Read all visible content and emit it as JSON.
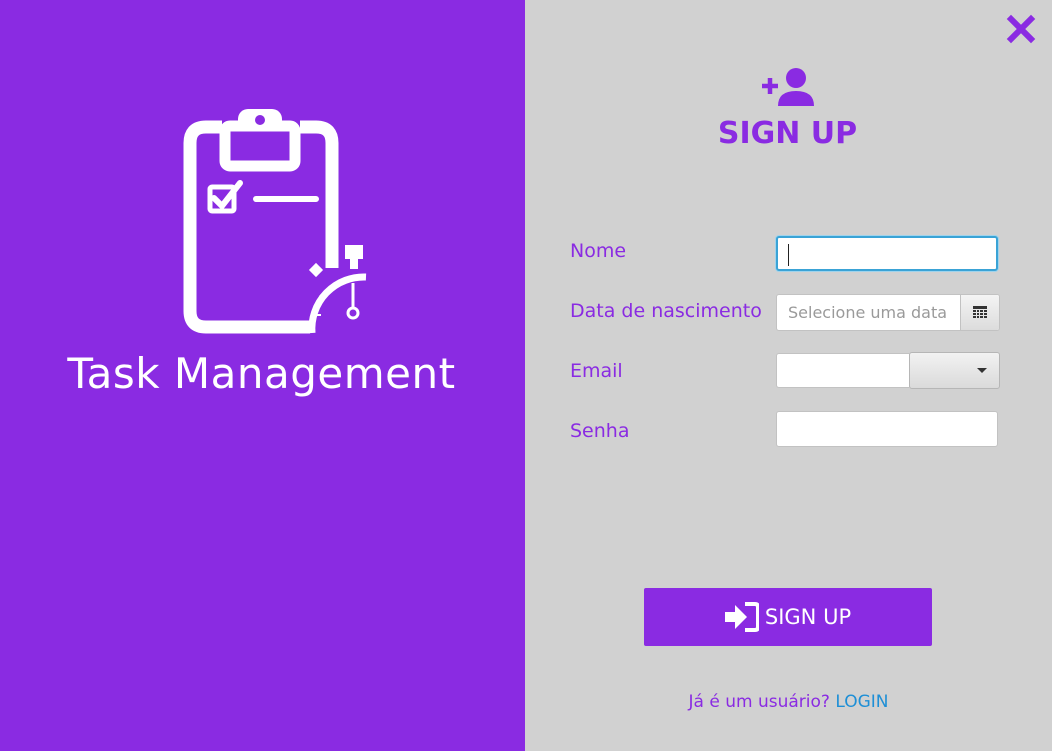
{
  "app": {
    "title": "Task Management"
  },
  "icons": {
    "logo": "clipboard-stopwatch-icon",
    "header": "add-user-icon",
    "close": "close-icon",
    "calendar": "calendar-icon",
    "dropdown": "chevron-down-icon",
    "sign_in": "sign-in-icon"
  },
  "colors": {
    "accent": "#8a2be2",
    "panel_bg": "#d1d1d1",
    "link": "#1e8fd6",
    "focus": "#3aa3d6"
  },
  "form": {
    "title": "SIGN UP",
    "fields": {
      "name": {
        "label": "Nome",
        "value": ""
      },
      "birthdate": {
        "label": "Data de nascimento",
        "placeholder": "Selecione uma data",
        "value": ""
      },
      "email": {
        "label": "Email",
        "value": "",
        "domain": ""
      },
      "password": {
        "label": "Senha",
        "value": ""
      }
    },
    "submit_label": "SIGN UP",
    "login_prompt": "Já é um usuário?",
    "login_link": "LOGIN"
  }
}
